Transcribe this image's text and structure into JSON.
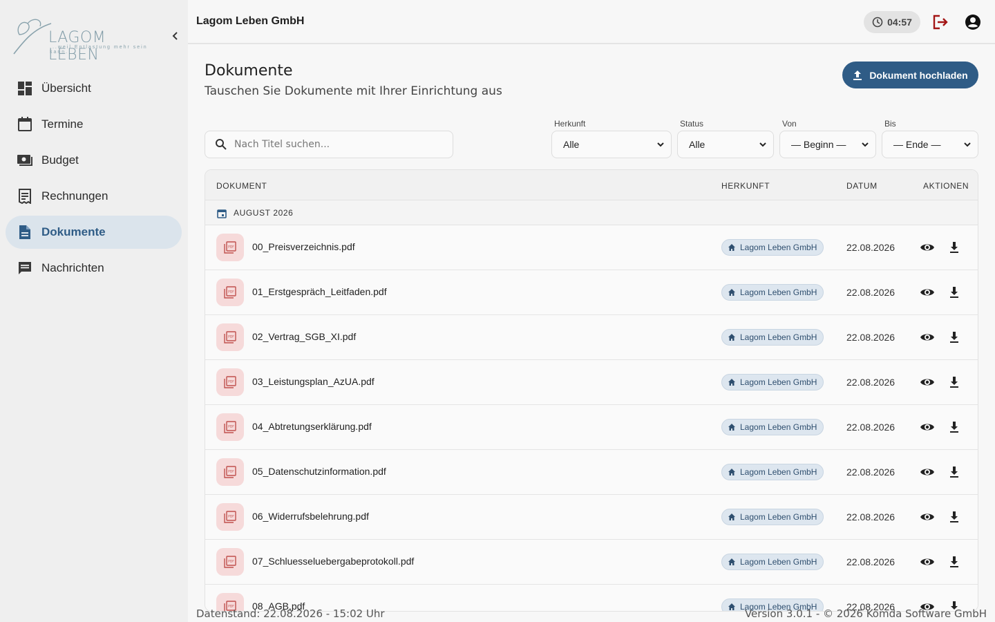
{
  "app": {
    "logo_text": "LAGOM LEBEN",
    "logo_tagline": "...weil Entlastung mehr sein kann."
  },
  "header": {
    "title": "Lagom Leben GmbH",
    "timer": "04:57"
  },
  "sidebar": {
    "items": [
      {
        "label": "Übersicht",
        "icon": "dashboard-icon",
        "active": false
      },
      {
        "label": "Termine",
        "icon": "calendar-icon",
        "active": false
      },
      {
        "label": "Budget",
        "icon": "money-icon",
        "active": false
      },
      {
        "label": "Rechnungen",
        "icon": "receipt-icon",
        "active": false
      },
      {
        "label": "Dokumente",
        "icon": "document-icon",
        "active": true
      },
      {
        "label": "Nachrichten",
        "icon": "message-icon",
        "active": false
      }
    ]
  },
  "page": {
    "title": "Dokumente",
    "subtitle": "Tauschen Sie Dokumente mit Ihrer Einrichtung aus",
    "upload_label": "Dokument hochladen"
  },
  "filters": {
    "search_placeholder": "Nach Titel suchen...",
    "herkunft_label": "Herkunft",
    "herkunft_value": "Alle",
    "status_label": "Status",
    "status_value": "Alle",
    "von_label": "Von",
    "von_value": "— Beginn —",
    "bis_label": "Bis",
    "bis_value": "— Ende —"
  },
  "table": {
    "headers": {
      "dokument": "DOKUMENT",
      "herkunft": "HERKUNFT",
      "datum": "DATUM",
      "aktionen": "AKTIONEN"
    },
    "group_label": "AUGUST 2026",
    "rows": [
      {
        "name": "00_Preisverzeichnis.pdf",
        "origin": "Lagom Leben GmbH",
        "date": "22.08.2026"
      },
      {
        "name": "01_Erstgespräch_Leitfaden.pdf",
        "origin": "Lagom Leben GmbH",
        "date": "22.08.2026"
      },
      {
        "name": "02_Vertrag_SGB_XI.pdf",
        "origin": "Lagom Leben GmbH",
        "date": "22.08.2026"
      },
      {
        "name": "03_Leistungsplan_AzUA.pdf",
        "origin": "Lagom Leben GmbH",
        "date": "22.08.2026"
      },
      {
        "name": "04_Abtretungserklärung.pdf",
        "origin": "Lagom Leben GmbH",
        "date": "22.08.2026"
      },
      {
        "name": "05_Datenschutzinformation.pdf",
        "origin": "Lagom Leben GmbH",
        "date": "22.08.2026"
      },
      {
        "name": "06_Widerrufsbelehrung.pdf",
        "origin": "Lagom Leben GmbH",
        "date": "22.08.2026"
      },
      {
        "name": "07_Schluesseluebergabeprotokoll.pdf",
        "origin": "Lagom Leben GmbH",
        "date": "22.08.2026"
      },
      {
        "name": "08_AGB.pdf",
        "origin": "Lagom Leben GmbH",
        "date": "22.08.2026"
      }
    ]
  },
  "footer": {
    "left": "Datenstand: 22.08.2026 - 15:02 Uhr",
    "right": "Version 3.0.1 - © 2026 Komda Software GmbH"
  },
  "colors": {
    "accent": "#2f5c86",
    "active_nav_bg": "#dbe4ec",
    "pdf_icon_bg": "#f6dada",
    "pdf_icon_fg": "#c0504d",
    "logout_red": "#a31515"
  }
}
